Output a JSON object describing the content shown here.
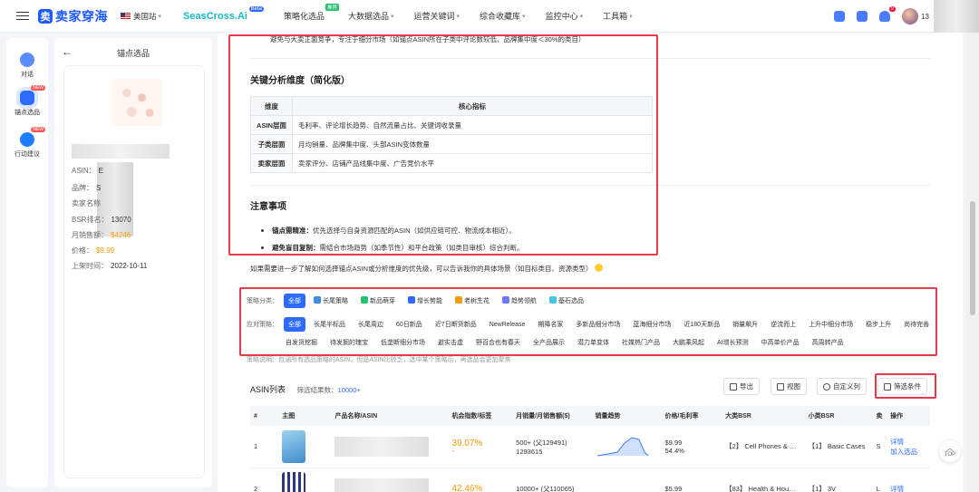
{
  "topnav": {
    "logo_mark": "卖",
    "logo_text": "卖家穿海",
    "region": "美国站",
    "brand": "SeasCross.Ai",
    "beta": "Beta",
    "items": [
      {
        "label": "策略化选品",
        "badge": "推荐"
      },
      {
        "label": "大数据选品",
        "badge": ""
      },
      {
        "label": "运营关键词",
        "badge": ""
      },
      {
        "label": "综合收藏库",
        "badge": ""
      },
      {
        "label": "监控中心",
        "badge": ""
      },
      {
        "label": "工具箱",
        "badge": ""
      }
    ],
    "notif_count": "9",
    "user_phone": "13"
  },
  "rail": {
    "items": [
      {
        "label": "对话",
        "new": ""
      },
      {
        "label": "锚点选品",
        "new": "NEW"
      },
      {
        "label": "行动建议",
        "new": "NEW"
      }
    ]
  },
  "product": {
    "title": "锚点选品",
    "fields": [
      {
        "k": "ASIN：",
        "v": "E",
        "orange": false
      },
      {
        "k": "品牌：",
        "v": "S",
        "orange": false
      },
      {
        "k": "卖家名称",
        "v": "",
        "orange": false
      },
      {
        "k": "BSR排名：",
        "v": "13070",
        "orange": false
      },
      {
        "k": "月销售额：",
        "v": "$4246",
        "orange": true
      },
      {
        "k": "价格：",
        "v": "$9.99",
        "orange": true
      },
      {
        "k": "上架时间：",
        "v": "2022-10-11",
        "orange": false
      }
    ]
  },
  "analysis": {
    "bullet_top": "避免与大卖正面竞争，专注于细分市场（如锚点ASIN所在子类中评论数较低、品牌集中度＜30%的类目）",
    "dim_title": "关键分析维度（简化版）",
    "dim_headers": [
      "维度",
      "核心指标"
    ],
    "dims": [
      {
        "k": "ASIN层面",
        "v": "毛利率、评论增长趋势、自然流量占比、关键词收录量"
      },
      {
        "k": "子类层面",
        "v": "月均销量、品牌集中度、头部ASIN变体数量"
      },
      {
        "k": "卖家层面",
        "v": "卖家评分、店铺产品线集中度、广告竞价水平"
      }
    ],
    "notes_title": "注意事项",
    "notes": [
      {
        "b": "锚点需精准：",
        "t": "优先选择与自身资源匹配的ASIN（如供应链可控、物流成本相近）。"
      },
      {
        "b": "避免盲目复制：",
        "t": "需结合市场趋势（如季节性）和平台政策（如类目审核）综合判断。"
      }
    ],
    "closing": "如果需要进一步了解如何选择锚点ASIN或分析维度的优先级，可以告诉我你的具体场景（如目标类目、资源类型）"
  },
  "strategy": {
    "cat_label": "策略分类：",
    "cats": [
      {
        "label": "全部",
        "on": true,
        "color": ""
      },
      {
        "label": "长尾策略",
        "on": false,
        "color": "#3a8ee6"
      },
      {
        "label": "新品萌芽",
        "on": false,
        "color": "#21c26b"
      },
      {
        "label": "增长势能",
        "on": false,
        "color": "#2d6bff"
      },
      {
        "label": "老树生花",
        "on": false,
        "color": "#f59a0f"
      },
      {
        "label": "趋势领航",
        "on": false,
        "color": "#6b7bff"
      },
      {
        "label": "基石选品",
        "on": false,
        "color": "#45c3e8"
      }
    ],
    "tac_label": "应对策略：",
    "tactics_row1": [
      "全部",
      "长尾半标品",
      "长尾周边",
      "60日新品",
      "近7日断货新品",
      "NewRelease",
      "期降名家",
      "多新品细分市场",
      "蓝海细分市场",
      "近180天新品",
      "销量飙升",
      "逆流而上",
      "上升中细分市场",
      "稳步上升",
      "尚待完善"
    ],
    "tactics_row2": [
      "自发货挖掘",
      "待发掘的瑰宝",
      "低垄断细分市场",
      "避实击虚",
      "野百合也有春天",
      "全产品展示",
      "潜力单变体",
      "社媒热门产品",
      "大鹏乘风起",
      "AI增长预测",
      "中高单价产品",
      "高周转产品"
    ],
    "note": "策略说明：包涵所有选品策略的ASIN，但是ASIN比较乏，选中某个策略后，再选品会更加聚焦"
  },
  "asin": {
    "title": "ASIN列表",
    "count_label": "筛选结果数：",
    "count": "10000+",
    "buttons": {
      "export": "导出",
      "view": "视图",
      "columns": "自定义列",
      "filter": "筛选条件"
    },
    "headers": [
      "#",
      "主图",
      "产品名称/ASIN",
      "机会指数/标签",
      "月销量/月销售额($)",
      "销量趋势",
      "价格/毛利率",
      "大类BSR",
      "小类BSR",
      "卖",
      "操作"
    ],
    "rows": [
      {
        "idx": "1",
        "opp": "39.07%",
        "opp_sub": "-",
        "sales": "500+ (父129491)",
        "sales_sub": "1293615",
        "price": "$9.99",
        "margin": "54.4%",
        "bsr_big": "【2】 Cell Phones & …",
        "bsr_small": "【1】 Basic Cases",
        "seller": "S",
        "op1": "详情",
        "op2": "加入选品",
        "thumb": "a"
      },
      {
        "idx": "2",
        "opp": "42.46%",
        "opp_sub": "",
        "sales": "10000+ (父110065)",
        "sales_sub": "",
        "price": "$5.99",
        "margin": "",
        "bsr_big": "【83】 Health & Hou…",
        "bsr_small": "【1】 3V",
        "seller": "L",
        "op1": "详情",
        "op2": "",
        "thumb": "b"
      }
    ]
  },
  "top_label": "TOP"
}
